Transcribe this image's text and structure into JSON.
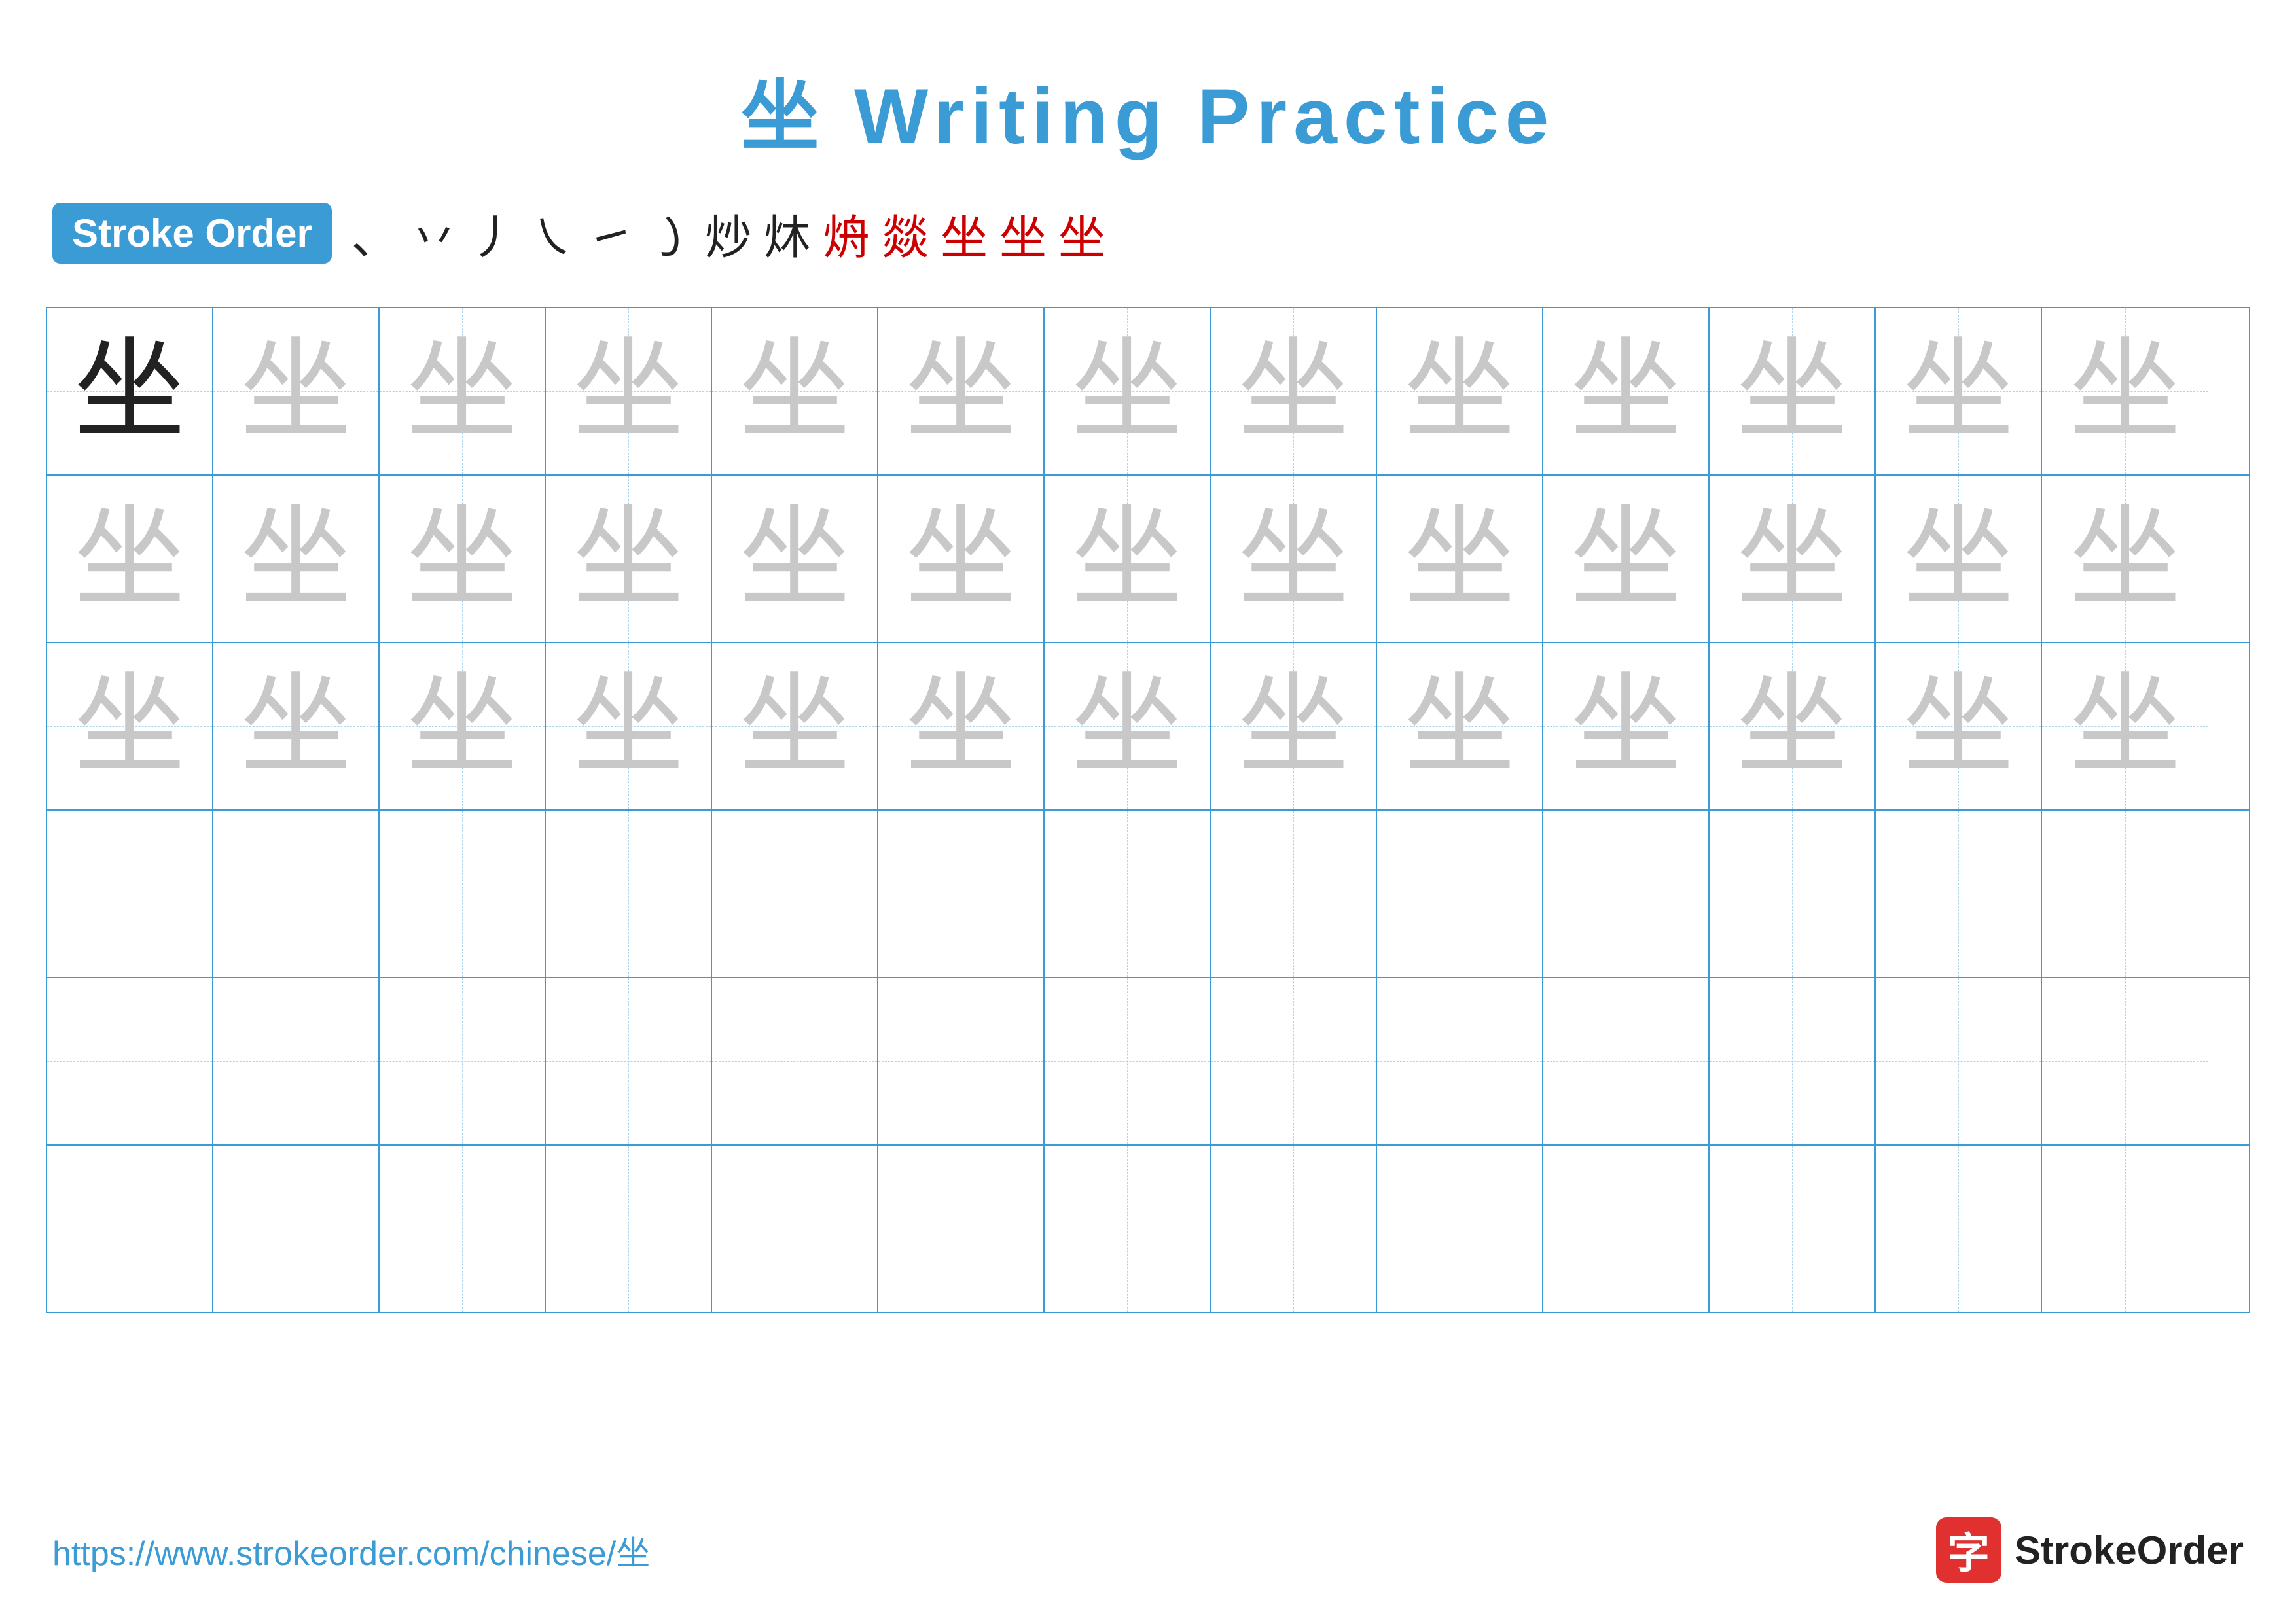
{
  "title": {
    "char": "坐",
    "label": "Writing Practice",
    "full": "坐 Writing Practice"
  },
  "stroke_order": {
    "badge_label": "Stroke Order",
    "strokes": [
      "丶",
      "丷",
      "丿",
      "乀",
      "㇏",
      "㇀",
      "炒",
      "炑",
      "㶧",
      "燚",
      "燚",
      "坐",
      "坐"
    ],
    "stroke_chars_display": [
      "、",
      "丷",
      "丿",
      "㇏",
      "㇀",
      "㇀丶",
      "炒",
      "炑",
      "㶧",
      "燚",
      "燚乚",
      "坐乚",
      "坐"
    ]
  },
  "grid": {
    "rows": 6,
    "cols": 13,
    "practice_char": "坐",
    "char_display": "坐"
  },
  "footer": {
    "url": "https://www.strokeorder.com/chinese/坐",
    "logo_text": "StrokeOrder",
    "logo_char": "字"
  }
}
